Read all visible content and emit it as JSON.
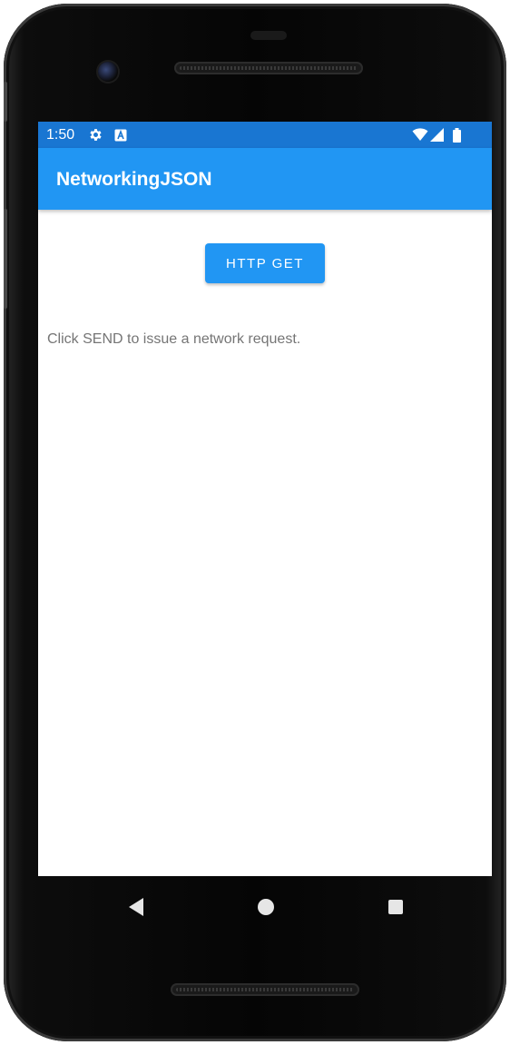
{
  "status_bar": {
    "time": "1:50",
    "icons": [
      "settings-gear-icon",
      "a-notification-icon",
      "wifi-icon",
      "signal-icon",
      "battery-icon"
    ],
    "color": "#1976d2"
  },
  "app_bar": {
    "title": "NetworkingJSON",
    "color": "#2196f3"
  },
  "main": {
    "http_get_button_label": "HTTP GET",
    "message": "Click SEND to issue a network request."
  },
  "nav_bar": {
    "icons": [
      "back-icon",
      "home-icon",
      "recents-icon"
    ]
  },
  "device": {
    "frame_color": "#050505"
  }
}
